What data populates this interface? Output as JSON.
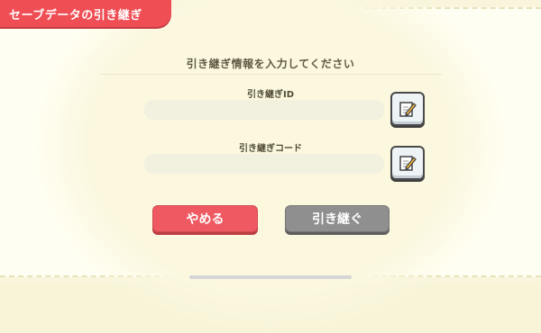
{
  "header": {
    "title": "セーブデータの引き継ぎ"
  },
  "form": {
    "instructions": "引き継ぎ情報を入力してください",
    "id_label": "引き継ぎID",
    "code_label": "引き継ぎコード",
    "id_value": "",
    "code_value": ""
  },
  "buttons": {
    "cancel_label": "やめる",
    "submit_label": "引き継ぐ"
  },
  "icons": {
    "edit": "edit-pencil-icon"
  },
  "colors": {
    "accent": "#ef4e55",
    "disabled_button": "#8f8f8f",
    "background": "#fffef2"
  }
}
